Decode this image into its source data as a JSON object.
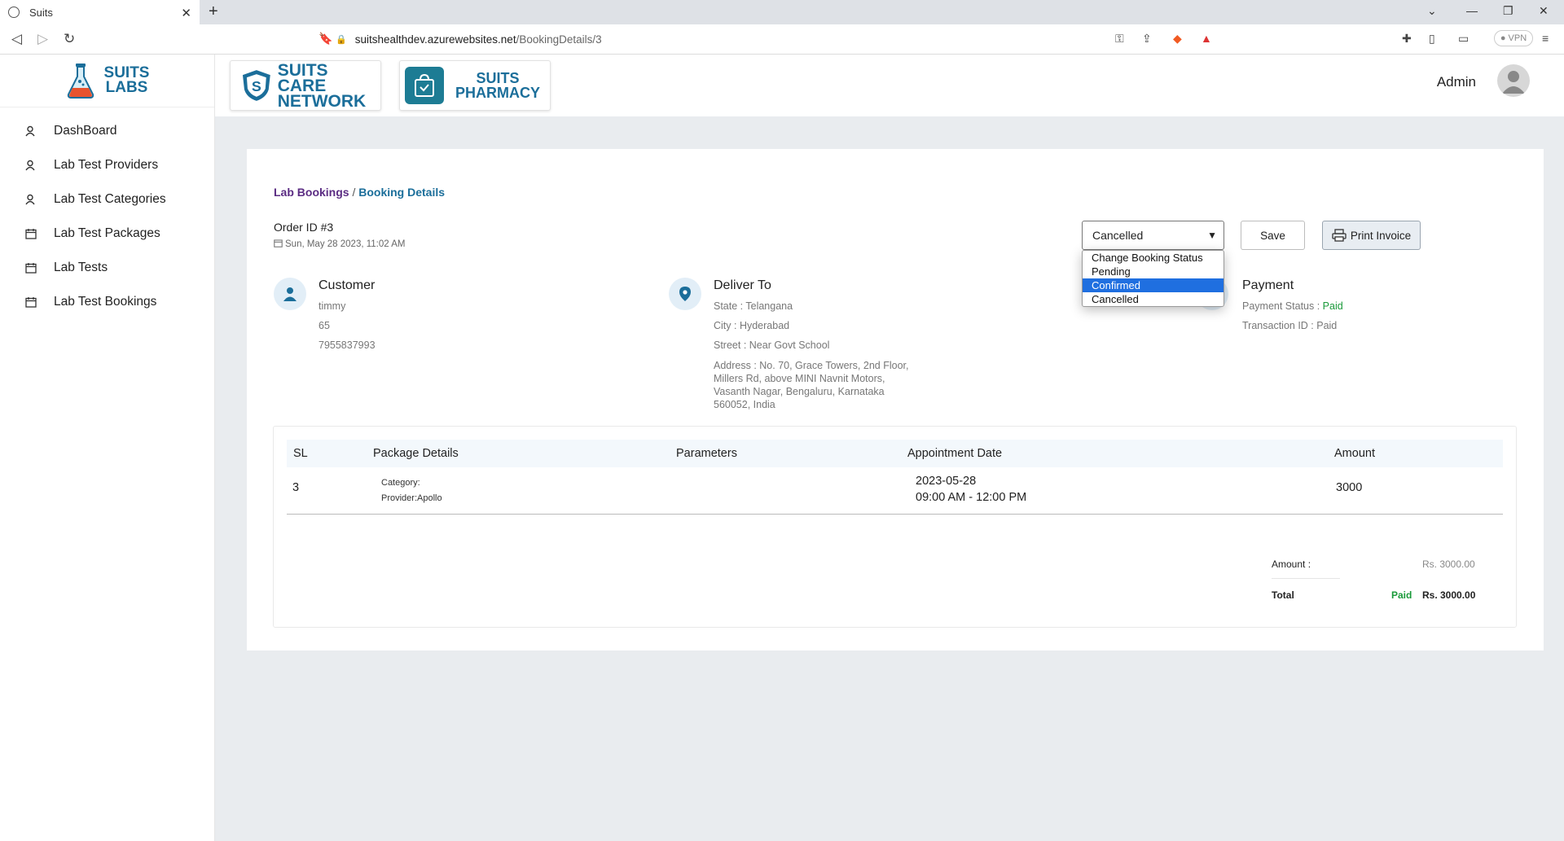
{
  "browser": {
    "tab_title": "Suits",
    "url_host": "suitshealthdev.azurewebsites.net",
    "url_path": "/BookingDetails/3",
    "vpn_label": "VPN"
  },
  "sidebar": {
    "brand_line1": "SUITS",
    "brand_line2": "LABS",
    "items": [
      {
        "label": "DashBoard",
        "icon": "user-icon"
      },
      {
        "label": "Lab Test Providers",
        "icon": "user-icon"
      },
      {
        "label": "Lab Test Categories",
        "icon": "user-icon"
      },
      {
        "label": "Lab Test Packages",
        "icon": "calendar-icon"
      },
      {
        "label": "Lab Tests",
        "icon": "calendar-icon"
      },
      {
        "label": "Lab Test Bookings",
        "icon": "calendar-icon"
      }
    ]
  },
  "header": {
    "logo1_line1": "SUITS CARE",
    "logo1_line2": "NETWORK",
    "logo2_line1": "SUITS",
    "logo2_line2": "PHARMACY",
    "user_name": "Admin"
  },
  "breadcrumb": {
    "parent": "Lab Bookings",
    "separator": " / ",
    "current": "Booking Details"
  },
  "order": {
    "id_label": "Order ID #3",
    "date": "Sun, May 28 2023, 11:02 AM"
  },
  "status": {
    "selected": "Cancelled",
    "options": [
      "Change Booking Status",
      "Pending",
      "Confirmed",
      "Cancelled"
    ],
    "highlighted": "Confirmed"
  },
  "buttons": {
    "save": "Save",
    "print": "Print Invoice"
  },
  "customer": {
    "title": "Customer",
    "name": "timmy",
    "line2": "65",
    "phone": "7955837993"
  },
  "deliver": {
    "title": "Deliver To",
    "state": "State : Telangana",
    "city": "City : Hyderabad",
    "street": "Street : Near Govt School",
    "address_l1": "Address : No. 70, Grace Towers, 2nd Floor,",
    "address_l2": "Millers Rd, above MINI Navnit Motors,",
    "address_l3": "Vasanth Nagar, Bengaluru, Karnataka",
    "address_l4": "560052, India"
  },
  "payment": {
    "title": "Payment",
    "status_label": "Payment Status : ",
    "status_value": "Paid",
    "transaction": "Transaction ID : Paid"
  },
  "table": {
    "headers": [
      "SL",
      "Package Details",
      "Parameters",
      "Appointment Date",
      "Amount"
    ],
    "rows": [
      {
        "sl": "3",
        "category": "Category:",
        "provider": "Provider:Apollo",
        "parameters": "",
        "date": "2023-05-28",
        "time": "09:00 AM - 12:00 PM",
        "amount": "3000"
      }
    ]
  },
  "totals": {
    "amount_label": "Amount :",
    "amount_value": "Rs. 3000.00",
    "total_label": "Total",
    "total_status": "Paid",
    "total_value": "Rs. 3000.00"
  },
  "colors": {
    "brand": "#1b6e9a",
    "breadcrumb_parent": "#5b2c83",
    "paid": "#1a9a3a",
    "dropdown_highlight": "#1f6fe0"
  }
}
